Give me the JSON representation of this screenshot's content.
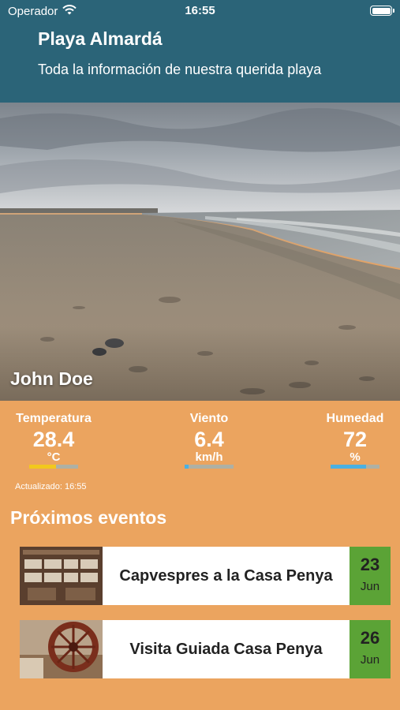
{
  "status_bar": {
    "carrier": "Operador",
    "time": "16:55"
  },
  "header": {
    "title": "Playa Almardá",
    "subtitle": "Toda la información de nuestra querida playa"
  },
  "hero": {
    "name": "John Doe"
  },
  "metrics": [
    {
      "label": "Temperatura",
      "value": "28.4",
      "unit": "°C",
      "level": 0.55,
      "color": "#f2c81d"
    },
    {
      "label": "Viento",
      "value": "6.4",
      "unit": "km/h",
      "level": 0.08,
      "color": "#4bb0e2"
    },
    {
      "label": "Humedad",
      "value": "72",
      "unit": "%",
      "level": 0.72,
      "color": "#4bb0e2"
    }
  ],
  "updated": "Actualizado: 16:55",
  "events_title": "Próximos eventos",
  "events": [
    {
      "title": "Capvespres a la Casa Penya",
      "day": "23",
      "month": "Jun"
    },
    {
      "title": "Visita Guiada Casa Penya",
      "day": "26",
      "month": "Jun"
    }
  ],
  "colors": {
    "header": "#2b6478",
    "date_badge": "#5ba336"
  }
}
